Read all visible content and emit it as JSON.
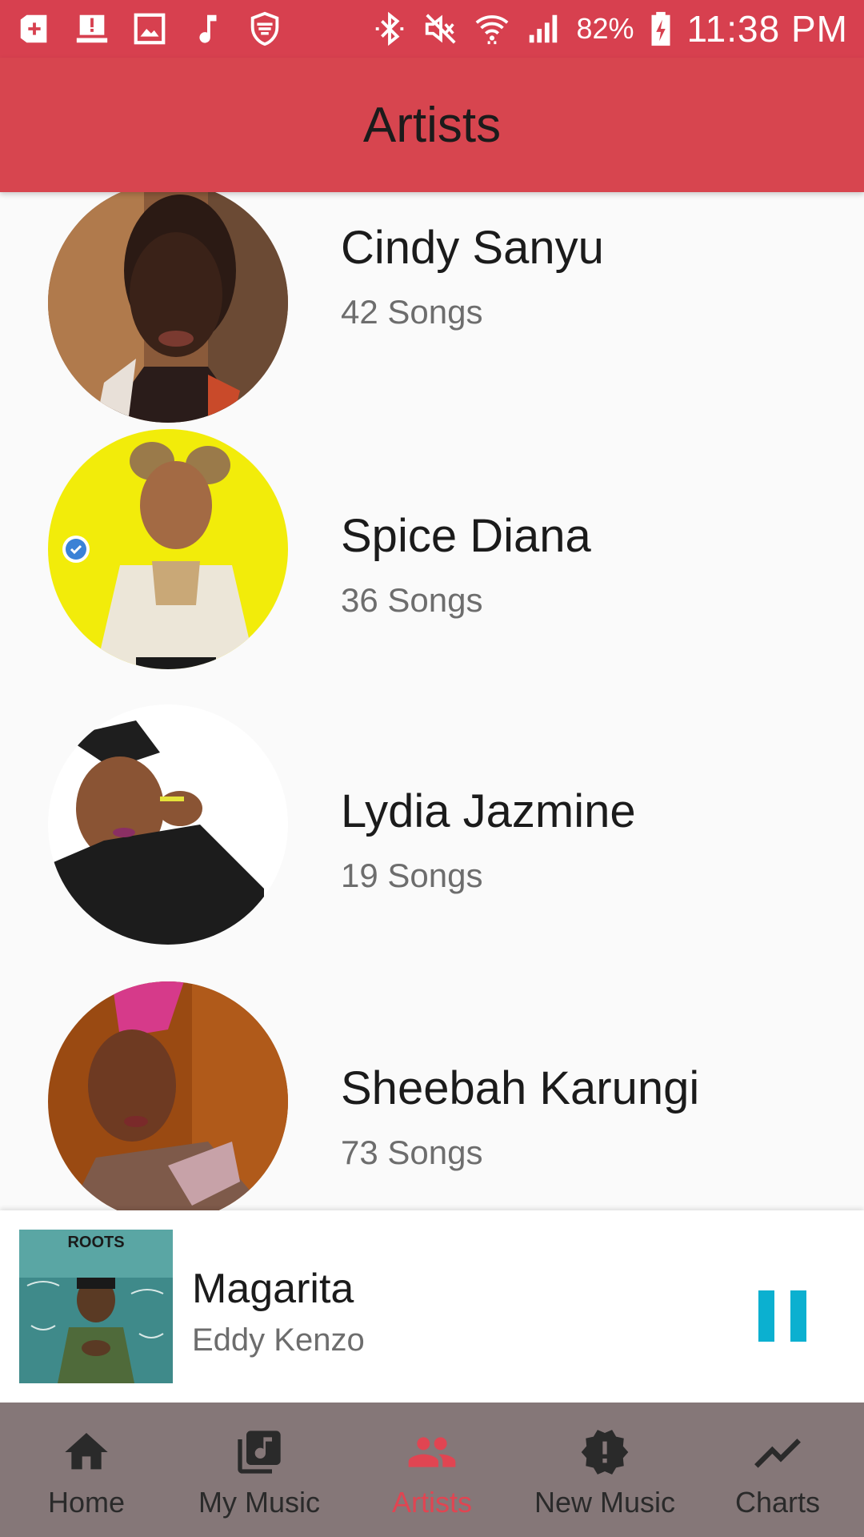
{
  "status_bar": {
    "battery": "82%",
    "time": "11:38 PM",
    "icons_left": [
      "add-box-icon",
      "alert-laptop-icon",
      "image-icon",
      "music-note-icon",
      "shield-icon"
    ],
    "icons_right": [
      "bluetooth-icon",
      "mute-icon",
      "wifi-icon",
      "signal-icon",
      "battery-charging-icon"
    ]
  },
  "app_bar": {
    "title": "Artists"
  },
  "artists": [
    {
      "name": "Cindy Sanyu",
      "songs": "42 Songs"
    },
    {
      "name": "Spice Diana",
      "songs": "36 Songs"
    },
    {
      "name": "Lydia Jazmine",
      "songs": "19 Songs"
    },
    {
      "name": "Sheebah Karungi",
      "songs": "73 Songs"
    }
  ],
  "now_playing": {
    "title": "Magarita",
    "artist": "Eddy Kenzo",
    "album_label": "ROOTS"
  },
  "bottom_nav": {
    "items": [
      {
        "label": "Home",
        "icon": "home-icon"
      },
      {
        "label": "My Music",
        "icon": "library-music-icon"
      },
      {
        "label": "Artists",
        "icon": "people-icon"
      },
      {
        "label": "New Music",
        "icon": "new-releases-icon"
      },
      {
        "label": "Charts",
        "icon": "trending-icon"
      }
    ],
    "active": "Artists"
  },
  "colors": {
    "status_bar": "#d7404f",
    "app_bar": "#d7454f",
    "bottom_nav": "#857778",
    "active_tab": "#e04552",
    "pause_button": "#0bb0d0"
  }
}
